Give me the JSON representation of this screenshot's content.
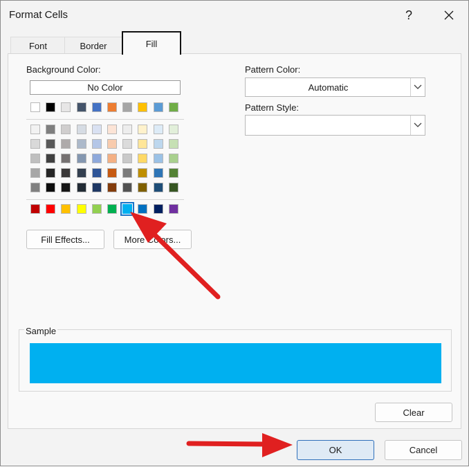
{
  "window": {
    "title": "Format Cells",
    "help_label": "?",
    "close_label": "✕"
  },
  "tabs": [
    {
      "label": "Font",
      "active": false
    },
    {
      "label": "Border",
      "active": false
    },
    {
      "label": "Fill",
      "active": true
    }
  ],
  "background_color": {
    "label": "Background Color:",
    "no_color_label": "No Color",
    "theme_row": [
      "#ffffff",
      "#000000",
      "#e7e6e6",
      "#44546a",
      "#4472c4",
      "#ed7d31",
      "#a5a5a5",
      "#ffc000",
      "#5b9bd5",
      "#70ad47"
    ],
    "tint_rows": [
      [
        "#f2f2f2",
        "#7f7f7f",
        "#d0cece",
        "#d6dce4",
        "#d9e1f2",
        "#fce4d6",
        "#ededed",
        "#fff2cc",
        "#ddebf7",
        "#e2efda"
      ],
      [
        "#d9d9d9",
        "#595959",
        "#aeaaaa",
        "#acb9ca",
        "#b4c6e7",
        "#f8cbad",
        "#dbdbdb",
        "#ffe699",
        "#bdd7ee",
        "#c6e0b4"
      ],
      [
        "#bfbfbf",
        "#404040",
        "#757171",
        "#8497b0",
        "#8ea9db",
        "#f4b084",
        "#c9c9c9",
        "#ffd966",
        "#9bc2e6",
        "#a9d08e"
      ],
      [
        "#a6a6a6",
        "#262626",
        "#3a3838",
        "#333f4f",
        "#2f5597",
        "#c65911",
        "#7b7b7b",
        "#bf8f00",
        "#2e75b6",
        "#548235"
      ],
      [
        "#808080",
        "#0d0d0d",
        "#161616",
        "#222b35",
        "#1f3864",
        "#833c0c",
        "#525252",
        "#7f6000",
        "#1f4e78",
        "#375623"
      ]
    ],
    "standard_row": [
      "#c00000",
      "#ff0000",
      "#ffc000",
      "#ffff00",
      "#92d050",
      "#00b050",
      "#00b0f0",
      "#0070c0",
      "#002060",
      "#7030a0"
    ],
    "selected_standard_index": 6
  },
  "buttons": {
    "fill_effects": "Fill Effects...",
    "more_colors": "More Colors...",
    "clear": "Clear",
    "ok": "OK",
    "cancel": "Cancel"
  },
  "pattern": {
    "color_label": "Pattern Color:",
    "color_value": "Automatic",
    "style_label": "Pattern Style:",
    "style_value": ""
  },
  "sample": {
    "label": "Sample",
    "color": "#00b0f0"
  },
  "annotation": {
    "arrow_color": "#e02020"
  }
}
